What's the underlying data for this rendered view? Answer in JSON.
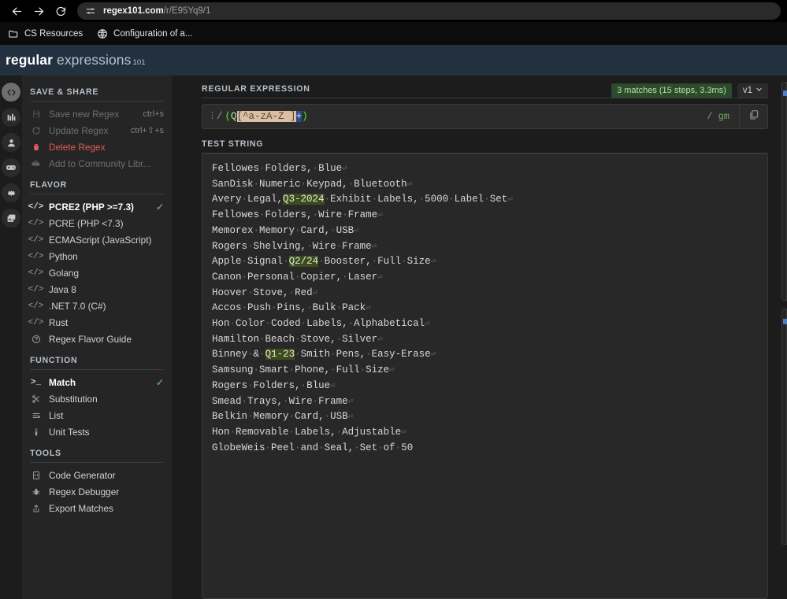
{
  "browser": {
    "back_icon": "back-arrow-icon",
    "forward_icon": "forward-arrow-icon",
    "reload_icon": "reload-icon",
    "site_settings_icon": "site-settings-sliders-icon",
    "url_domain": "regex101.com",
    "url_path": "/r/E95Yq9/1",
    "bookmarks": [
      {
        "label": "CS Resources",
        "icon": "folder-icon"
      },
      {
        "label": "Configuration of a...",
        "icon": "globe-icon"
      }
    ]
  },
  "header": {
    "logo_bold": "regular",
    "logo_light": "expressions",
    "logo_sup": "101"
  },
  "rail": [
    {
      "name": "code-icon",
      "glyph": "</>",
      "active": true
    },
    {
      "name": "library-icon",
      "glyph": "books",
      "active": false
    },
    {
      "name": "account-icon",
      "glyph": "person",
      "active": false
    },
    {
      "name": "game-controller-icon",
      "glyph": "gamepad",
      "active": false
    },
    {
      "name": "settings-gear-icon",
      "glyph": "gear",
      "active": false
    },
    {
      "name": "sponsor-cards-icon",
      "glyph": "cards",
      "active": false
    }
  ],
  "sidebar": {
    "save_share": {
      "title": "SAVE & SHARE",
      "items": [
        {
          "label": "Save new Regex",
          "shortcut": "ctrl+s",
          "icon": "save-disk-icon",
          "state": "disabled"
        },
        {
          "label": "Update Regex",
          "shortcut": "ctrl+⇧+s",
          "icon": "refresh-icon",
          "state": "disabled"
        },
        {
          "label": "Delete Regex",
          "shortcut": "",
          "icon": "trash-icon",
          "state": "danger"
        },
        {
          "label": "Add to Community Libr...",
          "shortcut": "",
          "icon": "cloud-upload-icon",
          "state": "disabled"
        }
      ]
    },
    "flavor": {
      "title": "FLAVOR",
      "items": [
        {
          "label": "PCRE2 (PHP >=7.3)",
          "icon": "code-icon",
          "selected": true
        },
        {
          "label": "PCRE (PHP <7.3)",
          "icon": "code-icon",
          "selected": false
        },
        {
          "label": "ECMAScript (JavaScript)",
          "icon": "code-icon",
          "selected": false
        },
        {
          "label": "Python",
          "icon": "code-icon",
          "selected": false
        },
        {
          "label": "Golang",
          "icon": "code-icon",
          "selected": false
        },
        {
          "label": "Java 8",
          "icon": "code-icon",
          "selected": false
        },
        {
          "label": ".NET 7.0 (C#)",
          "icon": "code-icon",
          "selected": false
        },
        {
          "label": "Rust",
          "icon": "code-icon",
          "selected": false
        },
        {
          "label": "Regex Flavor Guide",
          "icon": "question-circle-icon",
          "selected": false
        }
      ]
    },
    "function": {
      "title": "FUNCTION",
      "items": [
        {
          "label": "Match",
          "icon": "terminal-prompt-icon",
          "selected": true
        },
        {
          "label": "Substitution",
          "icon": "scissors-icon",
          "selected": false
        },
        {
          "label": "List",
          "icon": "list-icon",
          "selected": false
        },
        {
          "label": "Unit Tests",
          "icon": "test-tube-icon",
          "selected": false
        }
      ]
    },
    "tools": {
      "title": "TOOLS",
      "items": [
        {
          "label": "Code Generator",
          "icon": "code-file-icon"
        },
        {
          "label": "Regex Debugger",
          "icon": "bug-icon"
        },
        {
          "label": "Export Matches",
          "icon": "export-upload-icon"
        }
      ]
    }
  },
  "regex_panel": {
    "label": "REGULAR EXPRESSION",
    "match_badge": "3 matches (15 steps, 3.3ms)",
    "version_label": "v1",
    "version_caret_icon": "chevron-down-icon",
    "options_icon": "vertical-dots-icon",
    "delim_open": "/",
    "delim_close": "/",
    "flags": "gm",
    "copy_icon": "copy-icon",
    "pattern": "(Q[^a-zA-Z ]+)",
    "tokens": [
      {
        "text": "(",
        "type": "group"
      },
      {
        "text": "Q",
        "type": "literal"
      },
      {
        "text": "[^a-zA-Z ]",
        "type": "charclass"
      },
      {
        "text": "+",
        "type": "quantifier"
      },
      {
        "text": ")",
        "type": "group"
      }
    ]
  },
  "test_string_panel": {
    "label": "TEST STRING",
    "lines": [
      {
        "text": "Fellowes Folders, Blue",
        "eol": true,
        "match": null
      },
      {
        "text": "SanDisk Numeric Keypad, Bluetooth",
        "eol": true,
        "match": null
      },
      {
        "text": "Avery Legal,Q3-2024 Exhibit Labels, 5000 Label Set",
        "eol": true,
        "match": "Q3-2024"
      },
      {
        "text": "Fellowes Folders, Wire Frame",
        "eol": true,
        "match": null
      },
      {
        "text": "Memorex Memory Card, USB",
        "eol": true,
        "match": null
      },
      {
        "text": "Rogers Shelving, Wire Frame",
        "eol": true,
        "match": null
      },
      {
        "text": "Apple Signal Q2/24 Booster, Full Size",
        "eol": true,
        "match": "Q2/24"
      },
      {
        "text": "Canon Personal Copier, Laser",
        "eol": true,
        "match": null
      },
      {
        "text": "Hoover Stove, Red",
        "eol": true,
        "match": null
      },
      {
        "text": "Accos Push Pins, Bulk Pack",
        "eol": true,
        "match": null
      },
      {
        "text": "Hon Color Coded Labels, Alphabetical",
        "eol": true,
        "match": null
      },
      {
        "text": "Hamilton Beach Stove, Silver",
        "eol": true,
        "match": null
      },
      {
        "text": "Binney & Q1-23 Smith Pens, Easy-Erase",
        "eol": true,
        "match": "Q1-23"
      },
      {
        "text": "Samsung Smart Phone, Full Size",
        "eol": true,
        "match": null
      },
      {
        "text": "Rogers Folders, Blue",
        "eol": true,
        "match": null
      },
      {
        "text": "Smead Trays, Wire Frame",
        "eol": true,
        "match": null
      },
      {
        "text": "Belkin Memory Card, USB",
        "eol": true,
        "match": null
      },
      {
        "text": "Hon Removable Labels, Adjustable",
        "eol": true,
        "match": null
      },
      {
        "text": "GlobeWeis Peel and Seal, Set of 50",
        "eol": false,
        "match": null
      }
    ]
  },
  "colors": {
    "accent_green": "#4caf50",
    "match_highlight": "#3c4c1f",
    "badge_bg": "#2d4a2d",
    "danger": "#e05c5c",
    "header_bg": "#22303f"
  }
}
